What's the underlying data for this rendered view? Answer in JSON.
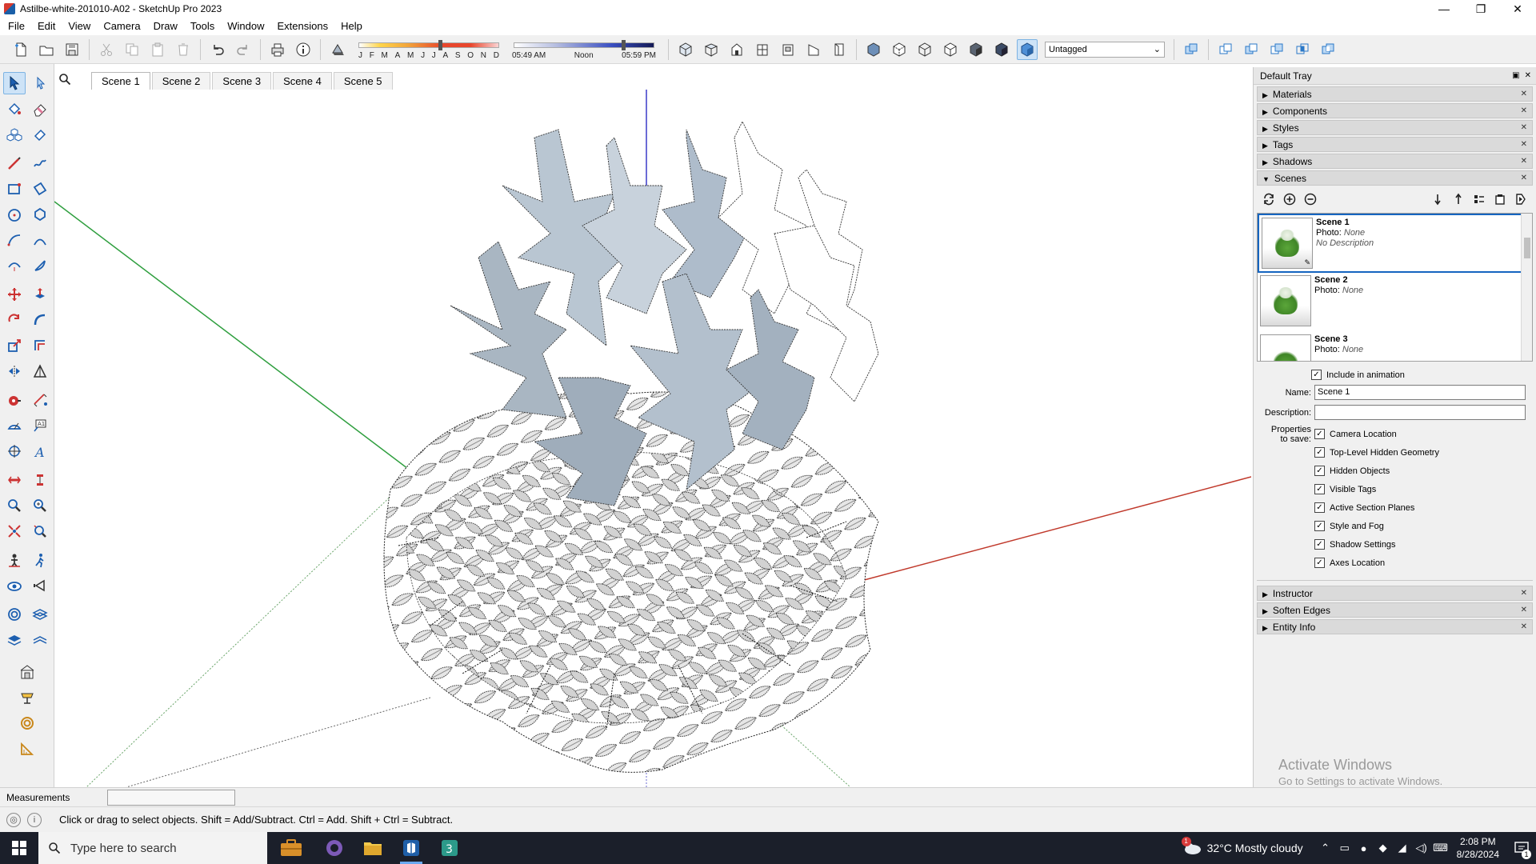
{
  "window": {
    "title": "Astilbe-white-201010-A02 - SketchUp Pro 2023",
    "minimize_glyph": "—",
    "restore_glyph": "❐",
    "close_glyph": "✕"
  },
  "menu": {
    "items": [
      "File",
      "Edit",
      "View",
      "Camera",
      "Draw",
      "Tools",
      "Window",
      "Extensions",
      "Help"
    ]
  },
  "toolbar": {
    "months": [
      "J",
      "F",
      "M",
      "A",
      "M",
      "J",
      "J",
      "A",
      "S",
      "O",
      "N",
      "D"
    ],
    "shadow_date_fraction": 0.58,
    "time_labels": [
      "05:49 AM",
      "Noon",
      "05:59 PM"
    ],
    "shadow_time_fraction": 0.78,
    "tag_selector": {
      "value": "Untagged",
      "arrow": "⌄"
    }
  },
  "scene_tabs": [
    "Scene 1",
    "Scene 2",
    "Scene 3",
    "Scene 4",
    "Scene 5"
  ],
  "tray": {
    "title": "Default Tray",
    "panels_top": [
      {
        "label": "Materials",
        "expanded": false
      },
      {
        "label": "Components",
        "expanded": false
      },
      {
        "label": "Styles",
        "expanded": false
      },
      {
        "label": "Tags",
        "expanded": false
      },
      {
        "label": "Shadows",
        "expanded": false
      },
      {
        "label": "Scenes",
        "expanded": true
      }
    ],
    "panels_bottom": [
      {
        "label": "Instructor",
        "expanded": false
      },
      {
        "label": "Soften Edges",
        "expanded": false
      },
      {
        "label": "Entity Info",
        "expanded": false
      }
    ],
    "glyphs": {
      "collapsed": "▶",
      "expanded": "▼",
      "close": "✕"
    },
    "scene_list": [
      {
        "name": "Scene 1",
        "photo_label": "Photo:",
        "photo_value": "None",
        "description": "No Description",
        "selected": true
      },
      {
        "name": "Scene 2",
        "photo_label": "Photo:",
        "photo_value": "None",
        "description": "",
        "selected": false
      },
      {
        "name": "Scene 3",
        "photo_label": "Photo:",
        "photo_value": "None",
        "description": "",
        "selected": false
      }
    ],
    "include_in_animation": "Include in animation",
    "name_label": "Name:",
    "name_value": "Scene 1",
    "description_label": "Description:",
    "description_value": "",
    "properties_label_1": "Properties",
    "properties_label_2": "to save:",
    "properties": [
      "Camera Location",
      "Top-Level Hidden Geometry",
      "Hidden Objects",
      "Visible Tags",
      "Active Section Planes",
      "Style and Fog",
      "Shadow Settings",
      "Axes Location"
    ]
  },
  "watermark": {
    "line1": "Activate Windows",
    "line2": "Go to Settings to activate Windows."
  },
  "measurements": {
    "label": "Measurements",
    "value": ""
  },
  "status": {
    "hint": "Click or drag to select objects. Shift = Add/Subtract. Ctrl = Add. Shift + Ctrl = Subtract."
  },
  "taskbar": {
    "search_placeholder": "Type here to search",
    "weather": "32°C  Mostly cloudy",
    "weather_badge": "1",
    "time": "2:08 PM",
    "date": "8/28/2024",
    "notification_count": "1"
  },
  "colors": {
    "axis_red": "#c0392b",
    "axis_green": "#2e9e3e",
    "axis_blue": "#3a3ac8",
    "selection_blue": "#1565c0",
    "taskbar_bg": "#1b1f2a"
  }
}
